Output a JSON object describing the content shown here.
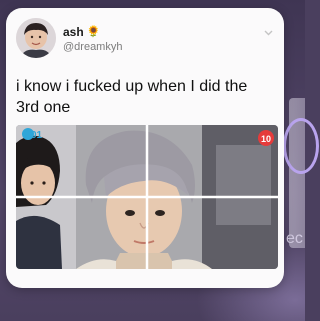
{
  "tweet": {
    "display_name": "ash",
    "name_emoji": "🌻",
    "handle": "@dreamkyh",
    "text": "i know i fucked up when I did the 3rd one"
  },
  "background": {
    "partial_text": "ec"
  },
  "media": {
    "overlay_left_label": "01",
    "overlay_right_label": "10"
  },
  "colors": {
    "card": "#fbfafb",
    "background": "#4a3f5e",
    "accent_ring": "#b9a4ee",
    "badge_red": "#e63b3b",
    "badge_blue": "#2fa6d8"
  },
  "icons": {
    "menu": "chevron-down-icon",
    "emoji": "sunflower-emoji"
  }
}
